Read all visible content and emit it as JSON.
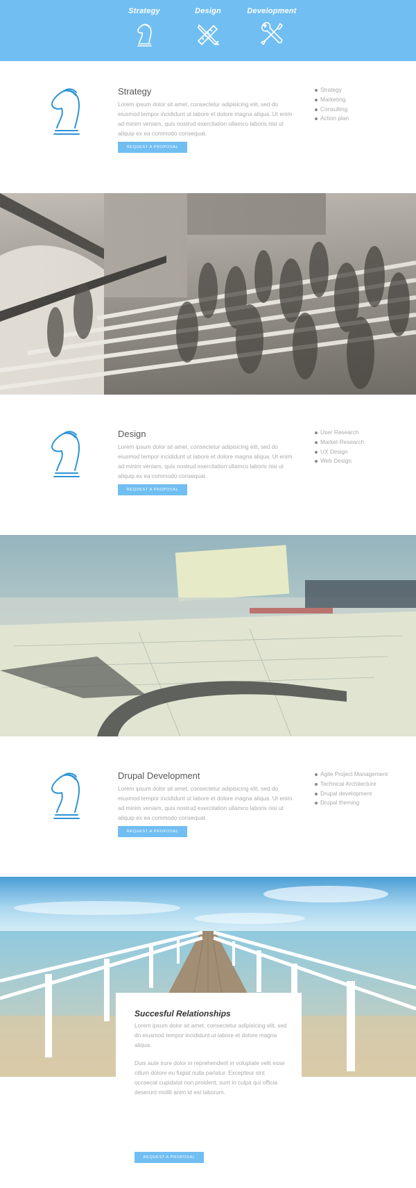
{
  "nav": {
    "items": [
      {
        "label": "Strategy",
        "icon": "knight-chess-icon"
      },
      {
        "label": "Design",
        "icon": "pencil-ruler-icon"
      },
      {
        "label": "Development",
        "icon": "wrench-screwdriver-icon"
      }
    ]
  },
  "colors": {
    "accent": "#71bef2",
    "knight": "#2d93d6",
    "text": "#777777"
  },
  "sections": [
    {
      "title": "Strategy",
      "description": "Lorem ipsum dolor sit amet, consectetur adipisicing elit, sed do eiusmod tempor incididunt ut labore et dolore magna aliqua. Ut enim ad minim veniam, quis nostrud exercitation ullamco laboris nisi ut aliquip ex ea commodo consequat.",
      "cta": "Request a proposal",
      "list": [
        "Strategy",
        "Marketing",
        "Consulting",
        "Action plan"
      ]
    },
    {
      "title": "Design",
      "description": "Lorem ipsum dolor sit amet, consectetur adipisicing elit, sed do eiusmod tempor incididunt ut labore et dolore magna aliqua. Ut enim ad minim veniam, quis nostrud exercitation ullamco laboris nisi ut aliquip ex ea commodo consequat.",
      "cta": "Request a proposal",
      "list": [
        "User Research",
        "Market Research",
        "UX Design",
        "Web Design"
      ]
    },
    {
      "title": "Drupal Development",
      "description": "Lorem ipsum dolor sit amet, consectetur adipisicing elit, sed do eiusmod tempor incididunt ut labore et dolore magna aliqua. Ut enim ad minim veniam, quis nostrud exercitation ullamco laboris nisi ut aliquip ex ea commodo consequat.",
      "cta": "Request a proposal",
      "list": [
        "Agile Project Management",
        "Technical Architecture",
        "Drupal development",
        "Drupal theming"
      ]
    }
  ],
  "card": {
    "title": "Succesful Relationships",
    "p1": "Lorem ipsum dolor sit amet, consectetur adipisicing elit, sed do eiusmod tempor incididunt ut labore et dolore magna aliqua.",
    "p2": "Duis aute irure dolor in reprehenderit in voluptate velit esse cillum dolore eu fugiat nulla pariatur. Excepteur sint occaecat cupidatat non proident, sunt in culpa qui officia deserunt mollit anim id est laborum.",
    "cta": "Request a proposal"
  }
}
